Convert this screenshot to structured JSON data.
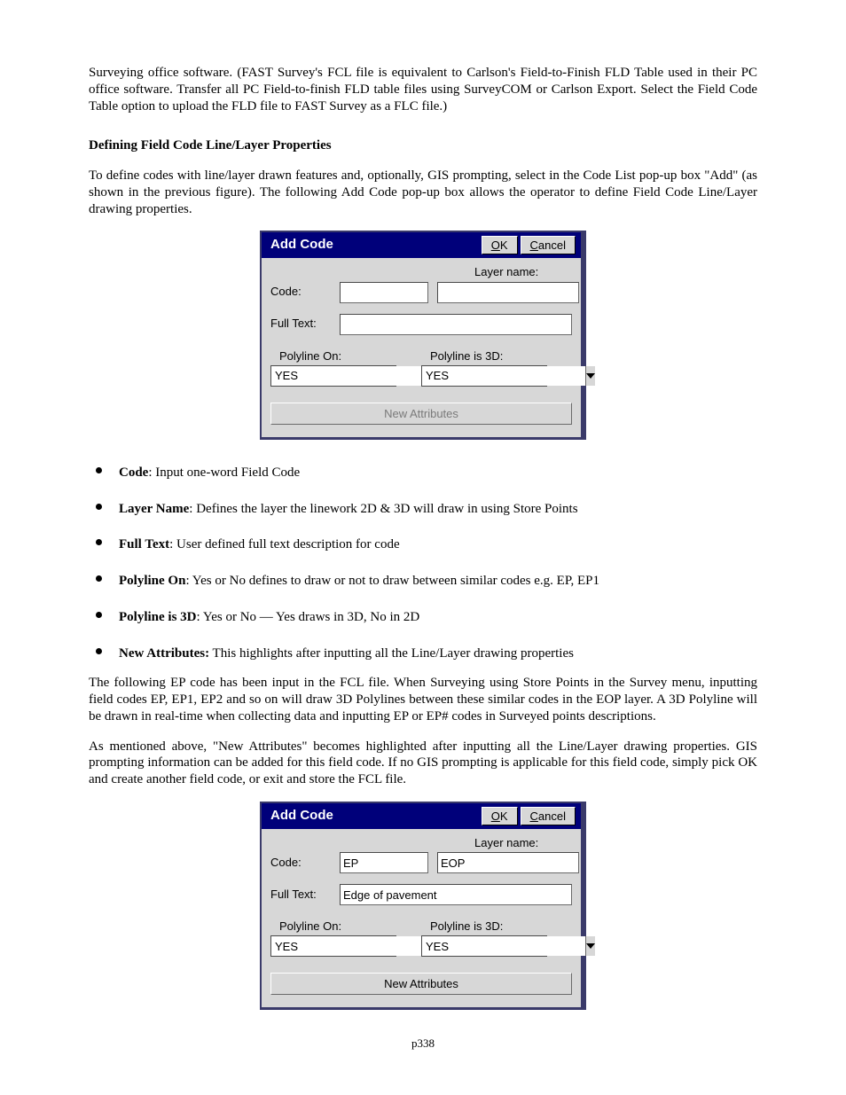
{
  "intro_para": "Surveying office software.  (FAST Survey's FCL file is equivalent to Carlson's Field-to-Finish FLD Table used in their PC office software.  Transfer all PC Field-to-finish FLD table files using SurveyCOM or Carlson Export.  Select the Field Code Table option to upload the FLD file to FAST Survey as a FLC file.)",
  "section_heading": "Defining Field Code Line/Layer Properties",
  "section_para": "To define codes with line/layer drawn features and, optionally, GIS prompting, select in the Code List pop-up box \"Add\" (as shown in the previous figure). The following Add Code pop-up box allows the operator to define Field Code Line/Layer drawing properties.",
  "dialog": {
    "title": "Add Code",
    "ok_plain": "K",
    "ok_u": "O",
    "cancel_plain": "ancel",
    "cancel_u": "C",
    "labels": {
      "code": "Code:",
      "layer": "Layer name:",
      "full_text": "Full Text:",
      "poly_on": "Polyline On:",
      "poly_3d": "Polyline is 3D:",
      "new_attr": "New Attributes"
    }
  },
  "dlg1": {
    "code": "",
    "layer": "",
    "full_text": "",
    "poly_on": "YES",
    "poly_3d": "YES",
    "new_attr_enabled": false
  },
  "dlg2": {
    "code": "EP",
    "layer": "EOP",
    "full_text": "Edge of pavement",
    "poly_on": "YES",
    "poly_3d": "YES",
    "new_attr_enabled": true
  },
  "bullets": [
    {
      "term": "Code",
      "desc": ": Input one-word Field Code"
    },
    {
      "term": "Layer Name",
      "desc": ": Defines the layer the linework 2D & 3D will draw in using Store Points"
    },
    {
      "term": "Full Text",
      "desc": ": User defined full text description for code"
    },
    {
      "term": "Polyline On",
      "desc": ": Yes or No defines to draw or not to draw between similar codes e.g. EP, EP1"
    },
    {
      "term": "Polyline is 3D",
      "desc": ": Yes or No — Yes draws in 3D, No in 2D"
    },
    {
      "term": "New Attributes:",
      "desc": " This highlights after inputting all the Line/Layer drawing properties"
    }
  ],
  "para_after_bullets": "The following EP code has been input in the FCL file. When Surveying using Store Points in the Survey menu, inputting field codes EP, EP1, EP2 and so on will draw 3D Polylines between these similar codes in the EOP layer.  A 3D Polyline will be drawn in real-time when collecting data and inputting EP or EP# codes in Surveyed points descriptions.",
  "para_before_dlg2": "As mentioned above, \"New Attributes\" becomes highlighted after inputting all the Line/Layer drawing properties. GIS prompting information can be added for this field code.  If no GIS prompting is applicable for this field code, simply pick OK and create another field code, or exit and store the FCL file.",
  "page_number": "p338"
}
